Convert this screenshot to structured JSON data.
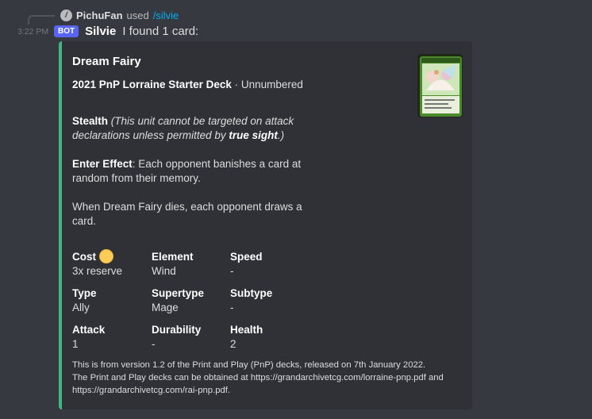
{
  "reply": {
    "username": "PichuFan",
    "used_text": "used",
    "command": "/silvie"
  },
  "message": {
    "timestamp": "3:22 PM",
    "bot_tag": "BOT",
    "author": "Silvie",
    "text": "I found 1 card:"
  },
  "embed": {
    "accent_color": "#43b581",
    "title": "Dream Fairy",
    "set_name": "2021 PnP Lorraine Starter Deck",
    "set_number": " · Unnumbered",
    "stealth_label": "Stealth",
    "stealth_text_1": "(This unit cannot be targeted on attack declarations unless permitted by ",
    "stealth_bold": "true sight",
    "stealth_text_2": ".)",
    "enter_label": "Enter Effect",
    "enter_text": ": Each opponent banishes a card at random from their memory.",
    "death_text": "When Dream Fairy dies, each opponent draws a card.",
    "fields": [
      {
        "name": "Cost",
        "value": "3x reserve",
        "icon": "reserve-coin-icon"
      },
      {
        "name": "Element",
        "value": "Wind"
      },
      {
        "name": "Speed",
        "value": "-"
      },
      {
        "name": "Type",
        "value": "Ally"
      },
      {
        "name": "Supertype",
        "value": "Mage"
      },
      {
        "name": "Subtype",
        "value": "-"
      },
      {
        "name": "Attack",
        "value": "1"
      },
      {
        "name": "Durability",
        "value": "-"
      },
      {
        "name": "Health",
        "value": "2"
      }
    ],
    "footer_line1": "This is from version 1.2 of the Print and Play (PnP) decks, released on 7th January 2022.",
    "footer_line2": "The Print and Play decks can be obtained at https://grandarchivetcg.com/lorraine-pnp.pdf and https://grandarchivetcg.com/rai-pnp.pdf."
  }
}
